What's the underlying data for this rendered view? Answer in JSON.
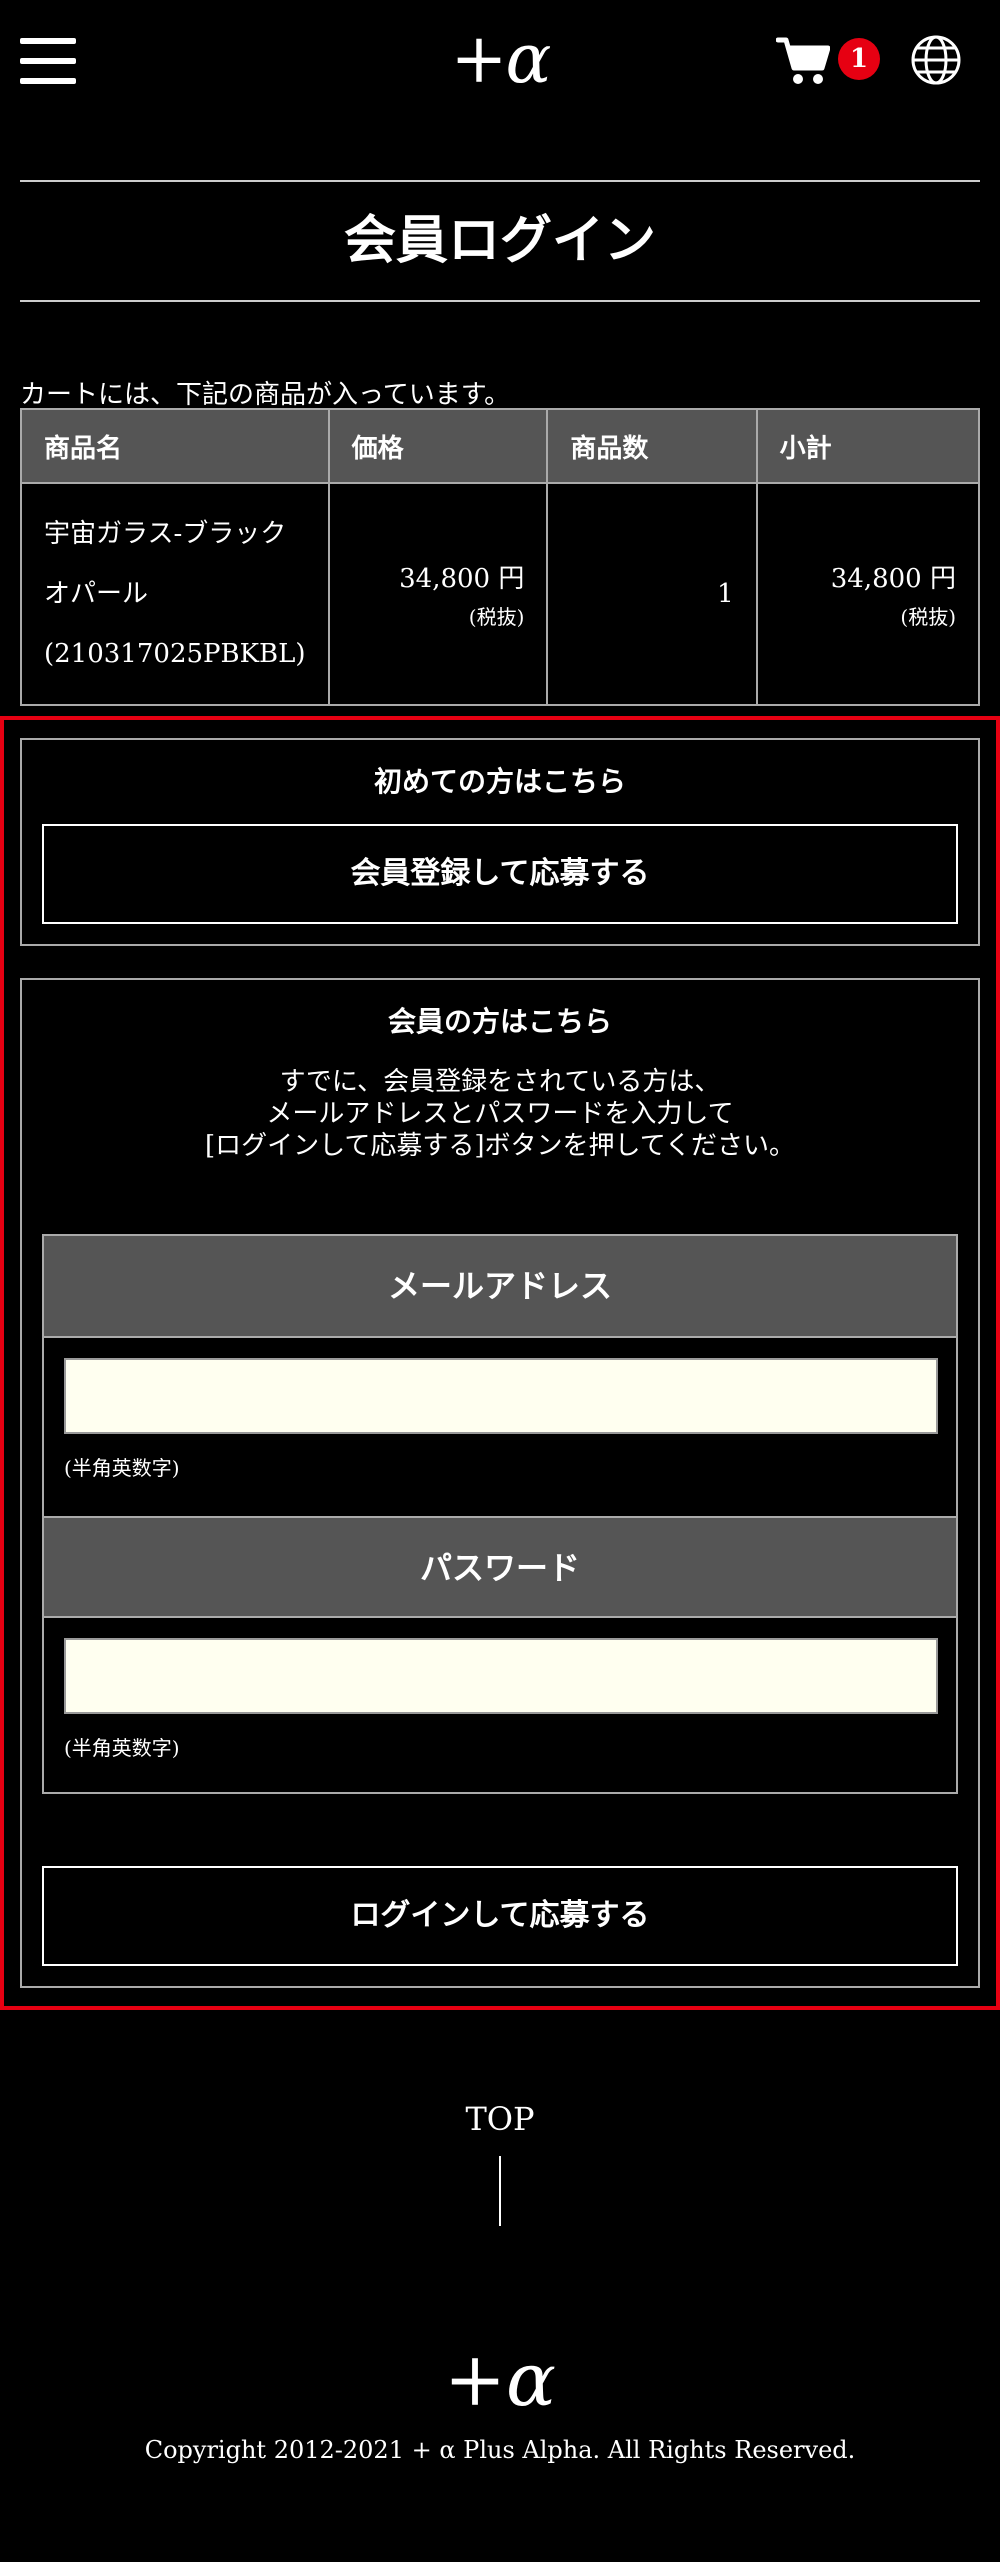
{
  "header": {
    "logo": "+α",
    "cart_count": "1"
  },
  "page_title": "会員ログイン",
  "cart": {
    "lead": "カートには、下記の商品が入っています。",
    "columns": [
      "商品名",
      "価格",
      "商品数",
      "小計"
    ],
    "rows": [
      {
        "name": "宇宙ガラス-ブラックオパール(210317025PBKBL)",
        "price": "34,800 円",
        "price_note": "(税抜)",
        "qty": "1",
        "subtotal": "34,800 円",
        "subtotal_note": "(税抜)"
      }
    ]
  },
  "first_time": {
    "heading": "初めての方はこちら",
    "button": "会員登録して応募する"
  },
  "member": {
    "heading": "会員の方はこちら",
    "note_lines": [
      "すでに、会員登録をされている方は、",
      "メールアドレスとパスワードを入力して",
      "[ログインして応募する]ボタンを押してください。"
    ],
    "email_label": "メールアドレス",
    "email_value": "",
    "email_hint": "(半角英数字)",
    "password_label": "パスワード",
    "password_value": "",
    "password_hint": "(半角英数字)",
    "button": "ログインして応募する"
  },
  "footer": {
    "top_link": "TOP",
    "logo": "+α",
    "copyright": "Copyright 2012-2021 + α Plus Alpha. All Rights Reserved."
  },
  "colors": {
    "background": "#000000",
    "badge": "#e60012",
    "highlight_border": "#e60012",
    "header_cell": "#555555",
    "input_bg": "#fffff0"
  },
  "icons": [
    "hamburger-menu-icon",
    "cart-icon",
    "globe-icon"
  ]
}
